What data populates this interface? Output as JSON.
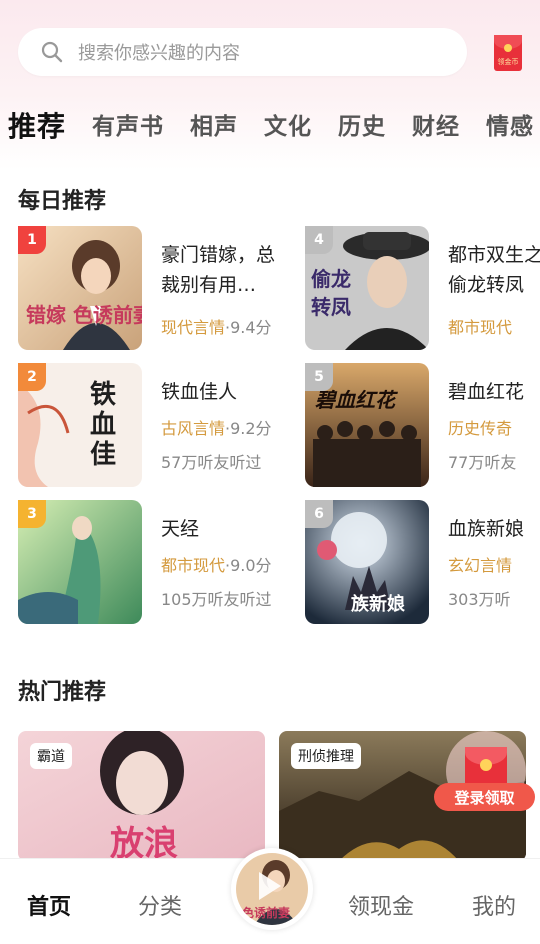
{
  "search": {
    "placeholder": "搜索你感兴趣的内容"
  },
  "top_redpacket": {
    "label": "领金币"
  },
  "tabs": [
    {
      "label": "推荐"
    },
    {
      "label": "有声书"
    },
    {
      "label": "相声"
    },
    {
      "label": "文化"
    },
    {
      "label": "历史"
    },
    {
      "label": "财经"
    },
    {
      "label": "情感"
    }
  ],
  "daily": {
    "title": "每日推荐",
    "books": [
      {
        "rank": "1",
        "title": "豪门错嫁，总裁别有用…",
        "genre": "现代言情",
        "score": "·9.4分",
        "listeners": "",
        "cover_text": "错嫁 色诱前妻",
        "rank_color": "#f0423e"
      },
      {
        "rank": "4",
        "title": "都市双生之偷龙转凤",
        "genre": "都市现代",
        "score": "",
        "listeners": "",
        "cover_text": "都市双生之 偷龙转凤",
        "rank_color": "#bdbdbd"
      },
      {
        "rank": "2",
        "title": "铁血佳人",
        "genre": "古风言情",
        "score": "·9.2分",
        "listeners": "57万听友听过",
        "cover_text": "铁血佳人",
        "rank_color": "#f28a3a"
      },
      {
        "rank": "5",
        "title": "碧血红花",
        "genre": "历史传奇",
        "score": "",
        "listeners": "77万听友",
        "cover_text": "碧血红花",
        "rank_color": "#bdbdbd"
      },
      {
        "rank": "3",
        "title": "天经",
        "genre": "都市现代",
        "score": "·9.0分",
        "listeners": "105万听友听过",
        "cover_text": "",
        "rank_color": "#f5b330"
      },
      {
        "rank": "6",
        "title": "血族新娘",
        "genre": "玄幻言情",
        "score": "",
        "listeners": "303万听",
        "cover_text": "血族新娘",
        "rank_color": "#bdbdbd"
      }
    ]
  },
  "hot": {
    "title": "热门推荐",
    "cards": [
      {
        "tag": "霸道",
        "cover_text": "放浪"
      },
      {
        "tag": "刑侦推理",
        "cover_text": ""
      }
    ]
  },
  "floating": {
    "login_label": "登录领取"
  },
  "tabbar": {
    "items": [
      {
        "label": "首页"
      },
      {
        "label": "分类"
      },
      {
        "label": "领现金"
      },
      {
        "label": "我的"
      }
    ]
  },
  "colors": {
    "accent": "#e8404a",
    "genre": "#d49a3e"
  }
}
